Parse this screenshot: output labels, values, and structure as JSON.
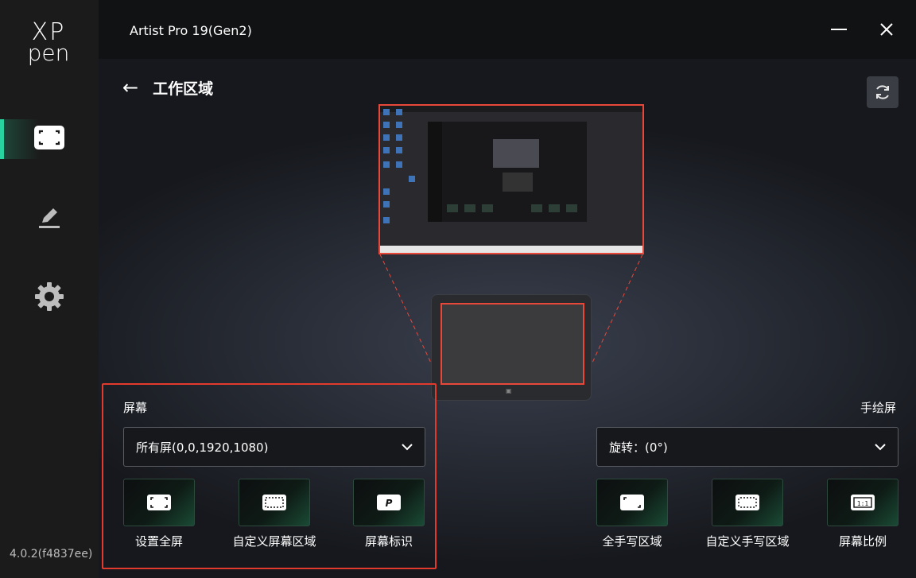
{
  "app": {
    "logo_top": "XP",
    "logo_bottom": "pen",
    "version": "4.0.2(f4837ee)"
  },
  "sidebar": {
    "items": [
      {
        "icon": "work-area-icon",
        "active": true
      },
      {
        "icon": "pen-icon",
        "active": false
      },
      {
        "icon": "gear-icon",
        "active": false
      }
    ]
  },
  "window": {
    "device_name": "Artist Pro 19(Gen2)",
    "minimize_icon": "minimize-icon",
    "close_icon": "close-icon"
  },
  "header": {
    "back_icon": "←",
    "title": "工作区域",
    "refresh_icon": "refresh-icon"
  },
  "screen_panel": {
    "label": "屏幕",
    "dropdown_value": "所有屏(0,0,1920,1080)",
    "buttons": [
      {
        "label": "设置全屏",
        "icon": "fullscreen-icon"
      },
      {
        "label": "自定义屏幕区域",
        "icon": "custom-area-icon"
      },
      {
        "label": "屏幕标识",
        "icon": "screen-identify-icon"
      }
    ]
  },
  "tablet_panel": {
    "label": "手绘屏",
    "dropdown_value": "旋转：(0°)",
    "buttons": [
      {
        "label": "全手写区域",
        "icon": "full-area-icon"
      },
      {
        "label": "自定义手写区域",
        "icon": "custom-pen-area-icon"
      },
      {
        "label": "屏幕比例",
        "icon": "ratio-icon"
      }
    ]
  },
  "colors": {
    "accent": "#29d3a0",
    "highlight": "#e23b2e",
    "mapping_line": "#e8483a"
  }
}
